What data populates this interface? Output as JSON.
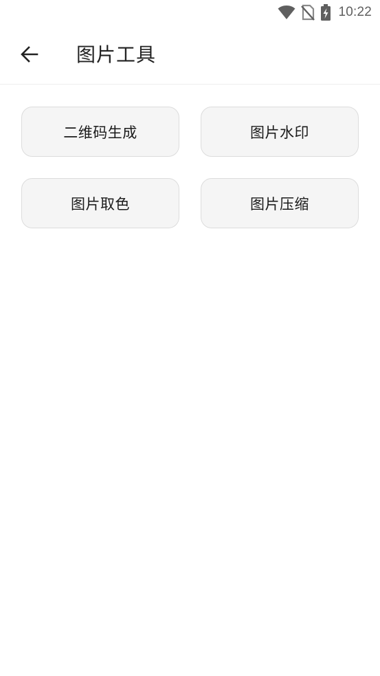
{
  "status_bar": {
    "time": "10:22",
    "icons": [
      "wifi-icon",
      "no-sim-icon",
      "battery-charging-icon"
    ]
  },
  "app_bar": {
    "back_icon": "arrow-left-icon",
    "title": "图片工具"
  },
  "tools": [
    {
      "label": "二维码生成"
    },
    {
      "label": "图片水印"
    },
    {
      "label": "图片取色"
    },
    {
      "label": "图片压缩"
    }
  ],
  "colors": {
    "background": "#ffffff",
    "button_bg": "#f5f5f5",
    "button_border": "#dcdcdc",
    "text": "#1b1b1b",
    "status_icon": "#5f5f5f"
  }
}
